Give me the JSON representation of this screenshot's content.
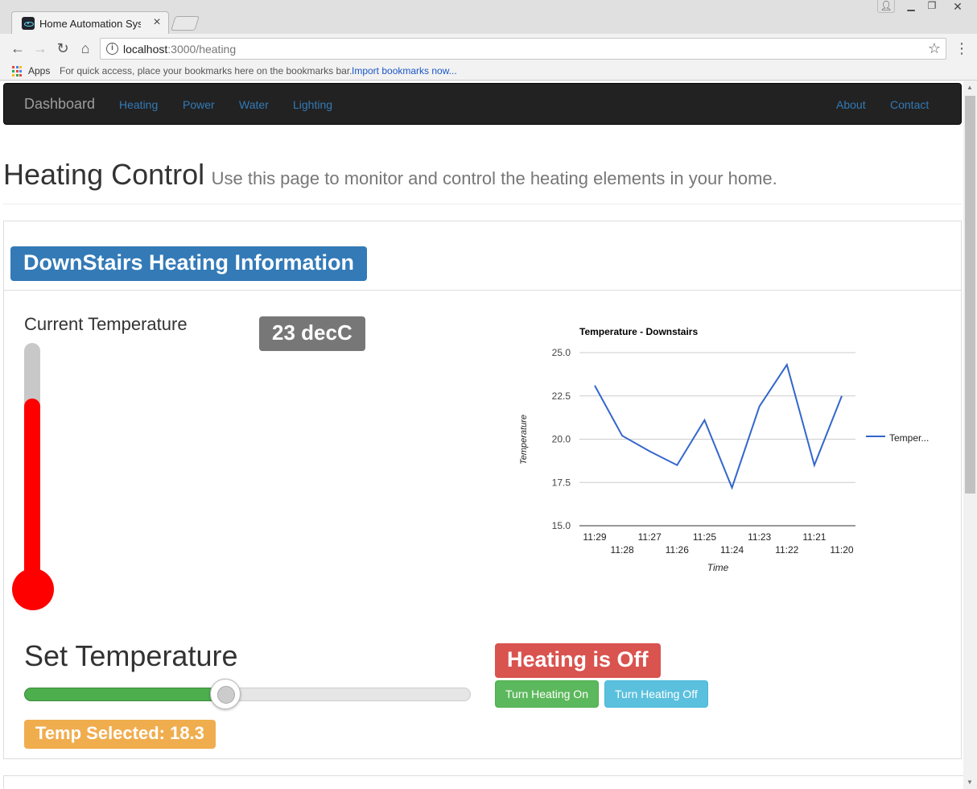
{
  "browser": {
    "tab_title": "Home Automation System",
    "url_host": "localhost",
    "url_path": ":3000/heating",
    "bookmarks": {
      "apps_label": "Apps",
      "hint": "For quick access, place your bookmarks here on the bookmarks bar.",
      "import_link": "Import bookmarks now..."
    }
  },
  "navbar": {
    "brand": "Dashboard",
    "left_links": [
      "Heating",
      "Power",
      "Water",
      "Lighting"
    ],
    "right_links": [
      "About",
      "Contact"
    ]
  },
  "header": {
    "title": "Heating Control",
    "subtitle": "Use this page to monitor and control the heating elements in your home."
  },
  "panel": {
    "heading": "DownStairs Heating Information",
    "current_label": "Current Temperature",
    "current_value": "23 decC",
    "current_fill_fraction": 0.77,
    "set_label": "Set Temperature",
    "slider_fraction": 0.45,
    "temp_selected": "Temp Selected: 18.3",
    "status": "Heating is Off",
    "btn_on": "Turn Heating On",
    "btn_off": "Turn Heating Off"
  },
  "colors": {
    "navbar": "#222222",
    "primary": "#337ab7",
    "danger": "#d9534f",
    "success": "#5cb85c",
    "info": "#5bc0de",
    "warning": "#f0ad4e",
    "thermometer": "#ff0000",
    "line": "#3366cc"
  },
  "chart_data": {
    "type": "line",
    "title": "Temperature - Downstairs",
    "xlabel": "Time",
    "ylabel": "Temperature",
    "ylim": [
      15.0,
      25.0
    ],
    "yticks": [
      "15.0",
      "17.5",
      "20.0",
      "22.5",
      "25.0"
    ],
    "grid": true,
    "legend_position": "right",
    "legend_label": "Temper...",
    "x": [
      "11:29",
      "11:28",
      "11:27",
      "11:26",
      "11:25",
      "11:24",
      "11:23",
      "11:22",
      "11:21",
      "11:20"
    ],
    "series": [
      {
        "values": [
          23.1,
          20.2,
          19.3,
          18.5,
          21.1,
          17.2,
          21.9,
          24.3,
          18.5,
          22.5
        ]
      }
    ]
  }
}
